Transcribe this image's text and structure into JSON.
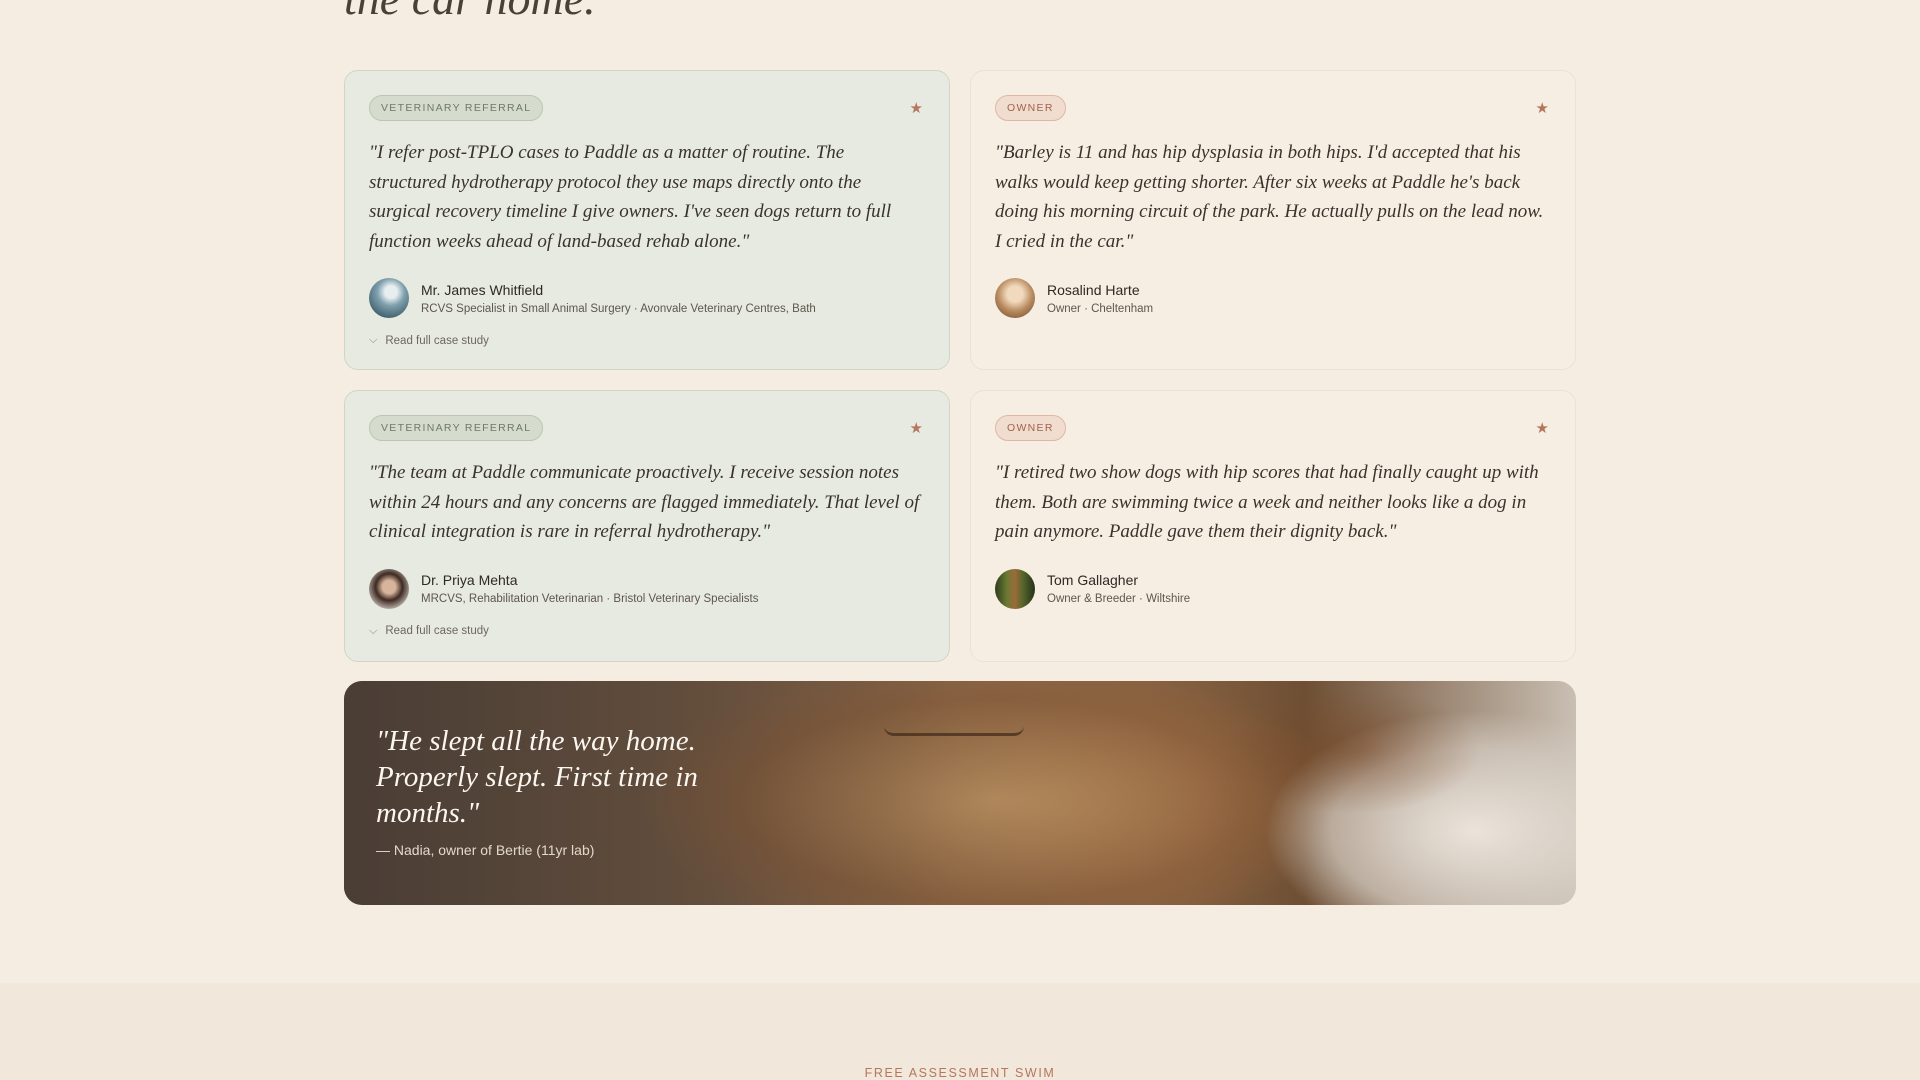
{
  "section": {
    "heading_fragment": "the car home."
  },
  "cards": [
    {
      "badge": "VETERINARY REFERRAL",
      "quote": "\"I refer post-TPLO cases to Paddle as a matter of routine. The structured hydrotherapy protocol they use maps directly onto the surgical recovery timeline I give owners. I've seen dogs return to full function weeks ahead of land-based rehab alone.\"",
      "name": "Mr. James Whitfield",
      "role": "RCVS Specialist in Small Animal Surgery · Avonvale Veterinary Centres, Bath",
      "link": "Read full case study",
      "icon": "star-icon"
    },
    {
      "badge": "OWNER",
      "quote": "\"Barley is 11 and has hip dysplasia in both hips. I'd accepted that his walks would keep getting shorter. After six weeks at Paddle he's back doing his morning circuit of the park. He actually pulls on the lead now. I cried in the car.\"",
      "name": "Rosalind Harte",
      "role": "Owner · Cheltenham",
      "icon": "star-icon"
    },
    {
      "badge": "VETERINARY REFERRAL",
      "quote": "\"The team at Paddle communicate proactively. I receive session notes within 24 hours and any concerns are flagged immediately. That level of clinical integration is rare in referral hydrotherapy.\"",
      "name": "Dr. Priya Mehta",
      "role": "MRCVS, Rehabilitation Veterinarian · Bristol Veterinary Specialists",
      "link": "Read full case study",
      "icon": "star-icon"
    },
    {
      "badge": "OWNER",
      "quote": "\"I retired two show dogs with hip scores that had finally caught up with them. Both are swimming twice a week and neither looks like a dog in pain anymore. Paddle gave them their dignity back.\"",
      "name": "Tom Gallagher",
      "role": "Owner & Breeder · Wiltshire",
      "icon": "star-icon"
    }
  ],
  "hero": {
    "quote": "\"He slept all the way home. Properly slept. First time in months.\"",
    "attribution": "— Nadia, owner of Bertie (11yr lab)"
  },
  "next_section": {
    "eyebrow": "FREE ASSESSMENT SWIM"
  },
  "colors": {
    "background": "#f5ede1",
    "accent": "#b5775d",
    "vet_card": "#e6eae0",
    "owner_card": "#f6eee3"
  }
}
